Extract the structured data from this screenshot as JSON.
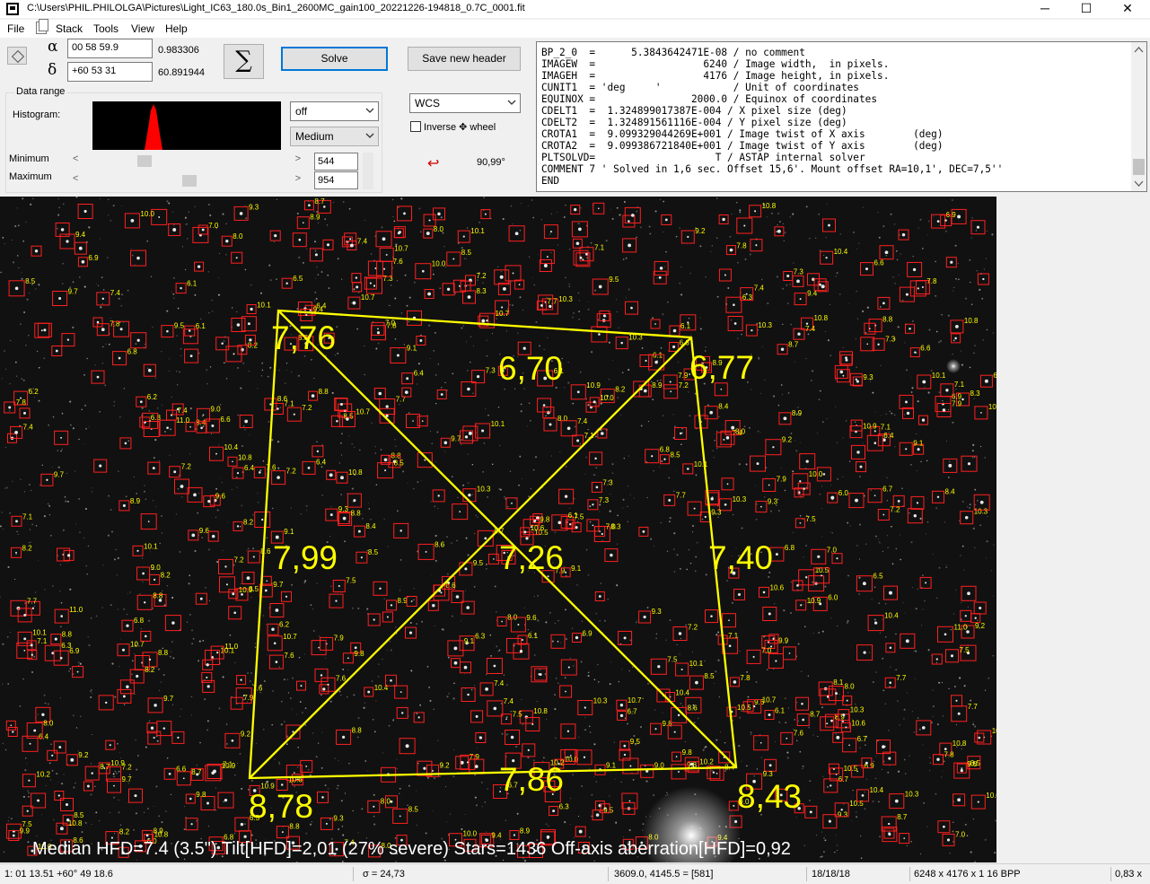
{
  "window": {
    "title": "C:\\Users\\PHIL.PHILOLGA\\Pictures\\Light_IC63_180.0s_Bin1_2600MC_gain100_20221226-194818_0.7C_0001.fit",
    "min_glyph": "─",
    "max_glyph": "☐",
    "close_glyph": "✕"
  },
  "menu": {
    "file": "File",
    "stack": "Stack",
    "tools": "Tools",
    "view": "View",
    "help": "Help"
  },
  "coords": {
    "alpha_symbol": "α",
    "delta_symbol": "δ",
    "ra_value": "00 58 59.9",
    "dec_value": "+60 53 31",
    "ra_decimal": "0.983306",
    "dec_decimal": "60.891944"
  },
  "toolbar": {
    "sum_symbol": "∑",
    "solve_label": "Solve",
    "save_header_label": "Save new header",
    "projection_value": "WCS",
    "inverse_wheel_label": "Inverse ✥ wheel",
    "rotation_value": "90,99°",
    "rotation_arrow": "↩"
  },
  "data_range": {
    "title": "Data range",
    "histogram_label": "Histogram:",
    "stretch_value": "off",
    "saturation_value": "Medium",
    "minimum_label": "Minimum",
    "maximum_label": "Maximum",
    "minimum_value": "544",
    "maximum_value": "954",
    "minimum_position": 0.27,
    "maximum_position": 0.5
  },
  "header_lines": [
    "BP_2_0  =      5.3843642471E-08 / no comment",
    "IMAGEW  =                  6240 / Image width,  in pixels.",
    "IMAGEH  =                  4176 / Image height, in pixels.",
    "CUNIT1  = 'deg     '            / Unit of coordinates",
    "EQUINOX =                2000.0 / Equinox of coordinates",
    "CDELT1  =  1.324899017387E-004 / X pixel size (deg)",
    "CDELT2  =  1.324891561116E-004 / Y pixel size (deg)",
    "CROTA1  =  9.099329044269E+001 / Image twist of X axis        (deg)",
    "CROTA2  =  9.099386721840E+001 / Image twist of Y axis        (deg)",
    "PLTSOLVD=                    T / ASTAP internal solver",
    "COMMENT 7 ' Solved in 1,6 sec. Offset 15,6'. Mount offset RA=10,1', DEC=7,5''",
    "END"
  ],
  "tilt_analysis": {
    "top_left": "7,76",
    "top_center": "6,70",
    "top_right": "6,77",
    "middle_left": "7,99",
    "center": "7,26",
    "middle_right": "7,40",
    "bottom_left": "8,78",
    "bottom_center": "7,86",
    "bottom_right": "8,43",
    "summary": "Median HFD=7.4 (3.5\")  Tilt[HFD]=2,01 (27% severe)  Stars=1436  Off-axis aberration[HFD]=0,92"
  },
  "statusbar": {
    "cursor_coords": "1: 01  13.51   +60° 49  18.6",
    "sigma": "σ = 24,73",
    "pixel_value": "3609.0, 4145.5 = [581]",
    "ratio": "18/18/18",
    "dimensions": "6248 x 4176 x 1   16 BPP",
    "zoom": "0,83 x"
  },
  "colors": {
    "annotation_yellow": "#ffff00",
    "star_box_red": "#ff2020",
    "histogram_red": "#ff0000",
    "solve_border": "#0078d7"
  }
}
